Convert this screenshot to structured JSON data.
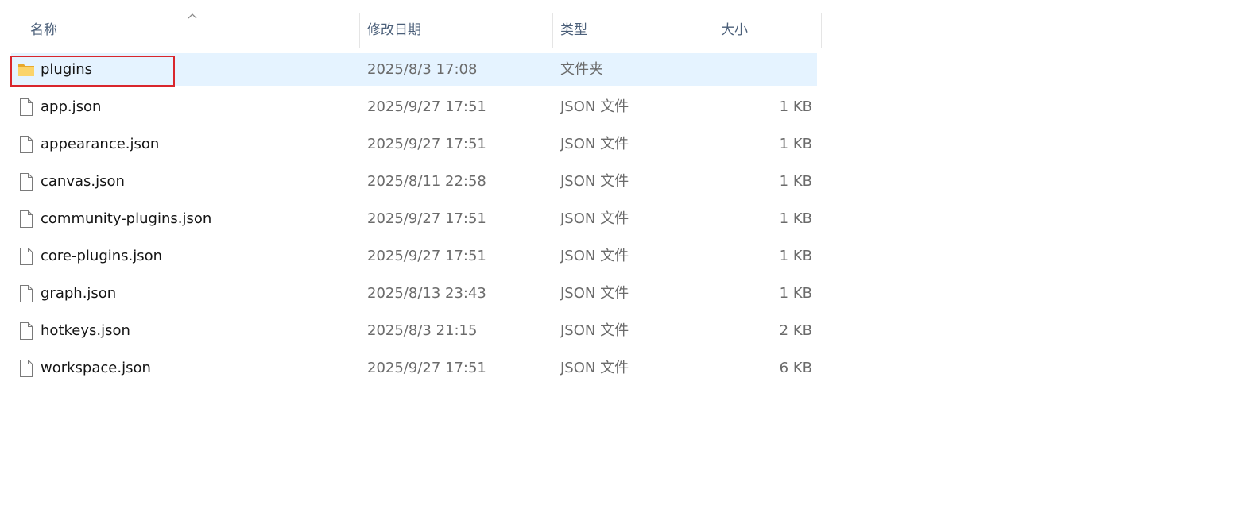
{
  "columns": {
    "name": "名称",
    "modified": "修改日期",
    "type": "类型",
    "size": "大小"
  },
  "sort": {
    "column": "name",
    "direction": "ascending",
    "icon": "chevron-up-icon"
  },
  "colors": {
    "selected_row": "#e5f3ff",
    "annotation_box": "#d9262c",
    "folder_icon": "#f8c94b",
    "header_text": "#4c607a"
  },
  "files": [
    {
      "name": "plugins",
      "modified": "2025/8/3 17:08",
      "type": "文件夹",
      "size": "",
      "icon": "folder-icon",
      "selected": true,
      "annotated": true
    },
    {
      "name": "app.json",
      "modified": "2025/9/27 17:51",
      "type": "JSON 文件",
      "size": "1 KB",
      "icon": "file-icon"
    },
    {
      "name": "appearance.json",
      "modified": "2025/9/27 17:51",
      "type": "JSON 文件",
      "size": "1 KB",
      "icon": "file-icon"
    },
    {
      "name": "canvas.json",
      "modified": "2025/8/11 22:58",
      "type": "JSON 文件",
      "size": "1 KB",
      "icon": "file-icon"
    },
    {
      "name": "community-plugins.json",
      "modified": "2025/9/27 17:51",
      "type": "JSON 文件",
      "size": "1 KB",
      "icon": "file-icon"
    },
    {
      "name": "core-plugins.json",
      "modified": "2025/9/27 17:51",
      "type": "JSON 文件",
      "size": "1 KB",
      "icon": "file-icon"
    },
    {
      "name": "graph.json",
      "modified": "2025/8/13 23:43",
      "type": "JSON 文件",
      "size": "1 KB",
      "icon": "file-icon"
    },
    {
      "name": "hotkeys.json",
      "modified": "2025/8/3 21:15",
      "type": "JSON 文件",
      "size": "2 KB",
      "icon": "file-icon"
    },
    {
      "name": "workspace.json",
      "modified": "2025/9/27 17:51",
      "type": "JSON 文件",
      "size": "6 KB",
      "icon": "file-icon"
    }
  ]
}
